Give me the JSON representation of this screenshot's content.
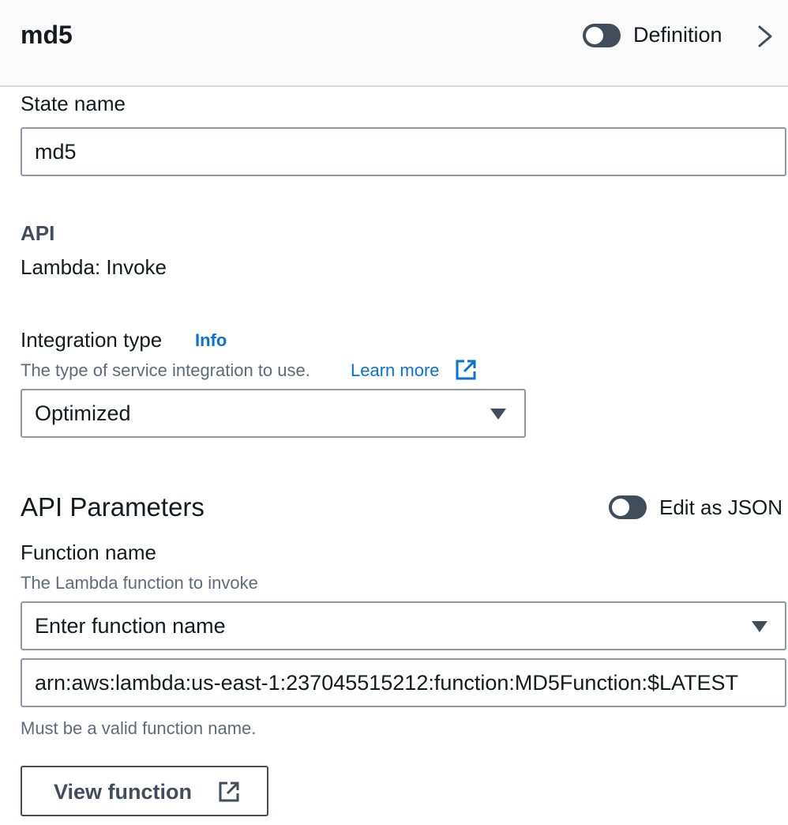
{
  "header": {
    "title": "md5",
    "definition_label": "Definition"
  },
  "state_name": {
    "label": "State name",
    "value": "md5"
  },
  "api": {
    "label": "API",
    "value": "Lambda: Invoke"
  },
  "integration_type": {
    "label": "Integration type",
    "info_link": "Info",
    "description": "The type of service integration to use.",
    "learn_more": "Learn more",
    "selected": "Optimized"
  },
  "api_parameters": {
    "title": "API Parameters",
    "edit_json_label": "Edit as JSON"
  },
  "function_name": {
    "label": "Function name",
    "description": "The Lambda function to invoke",
    "select_placeholder": "Enter function name",
    "arn_value": "arn:aws:lambda:us-east-1:237045515212:function:MD5Function:$LATEST",
    "constraint": "Must be a valid function name.",
    "view_button": "View function"
  },
  "icons": {
    "toggle": "toggle-off-icon",
    "chevron": "chevron-right-icon",
    "external": "external-link-icon",
    "caret": "caret-down-icon"
  }
}
